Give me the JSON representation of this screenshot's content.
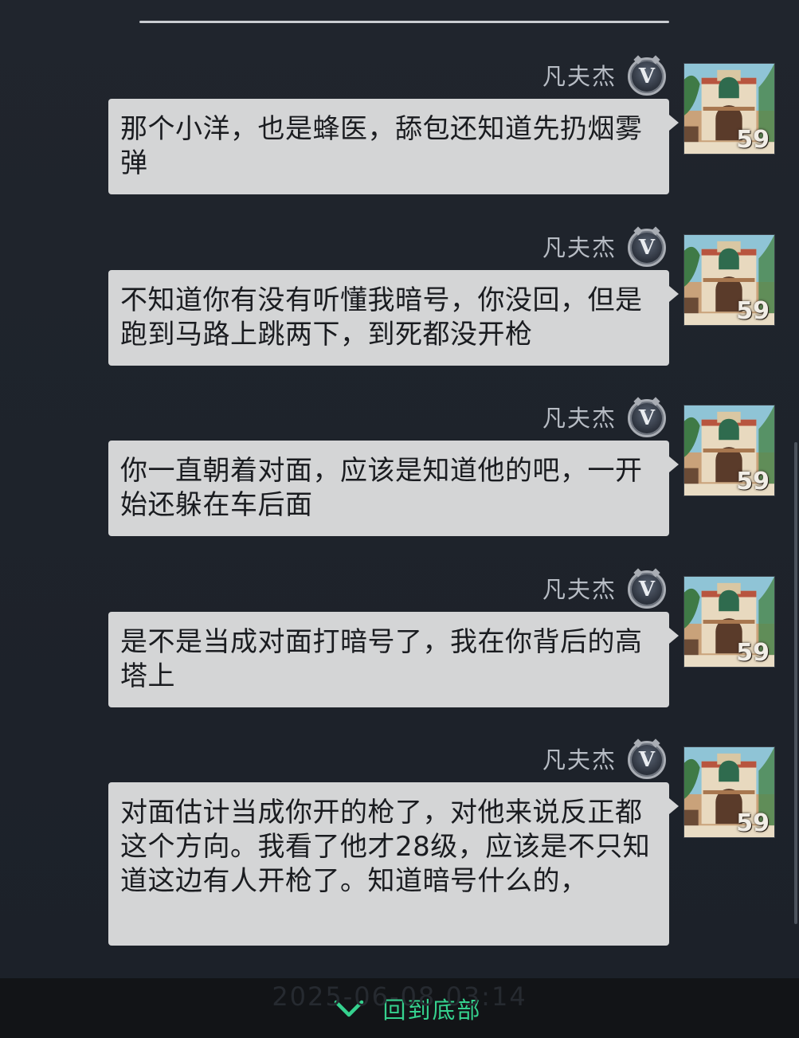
{
  "messages": [
    {
      "sender": "凡夫杰",
      "vip": "V",
      "level": "59",
      "text": "那个小洋，也是蜂医，舔包还知道先扔烟雾弹"
    },
    {
      "sender": "凡夫杰",
      "vip": "V",
      "level": "59",
      "text": "不知道你有没有听懂我暗号，你没回，但是跑到马路上跳两下，到死都没开枪"
    },
    {
      "sender": "凡夫杰",
      "vip": "V",
      "level": "59",
      "text": "你一直朝着对面，应该是知道他的吧，一开始还躲在车后面"
    },
    {
      "sender": "凡夫杰",
      "vip": "V",
      "level": "59",
      "text": "是不是当成对面打暗号了，我在你背后的高塔上"
    },
    {
      "sender": "凡夫杰",
      "vip": "V",
      "level": "59",
      "text": "对面估计当成你开的枪了，对他来说反正都这个方向。我看了他才28级，应该是不只知道这边有人开枪了。知道暗号什么的，"
    }
  ],
  "bottom_bar": {
    "timestamp": "2025-06-08 03:14",
    "back_label": "回到底部"
  },
  "colors": {
    "background": "#1e232b",
    "bubble": "#d4d5d6",
    "accent": "#35d18e"
  }
}
